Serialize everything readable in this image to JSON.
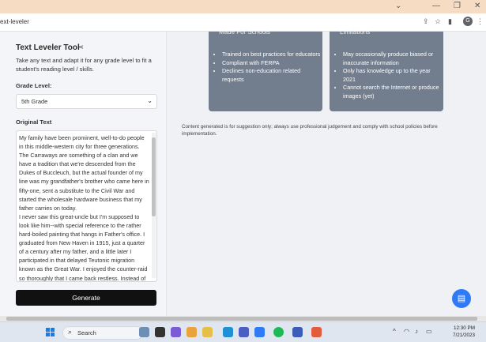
{
  "browser": {
    "window_controls": [
      "⌄",
      "—",
      "❐",
      "✕"
    ],
    "tab_text": "ext-leveler",
    "toolbar_icons": [
      "share-icon",
      "star-icon",
      "side-panel-icon",
      "profile-icon",
      "menu-icon"
    ],
    "profile_initial": "G"
  },
  "left_panel": {
    "title": "Text Leveler Tool",
    "description": "Take any text and adapt it for any grade level to fit a student's reading level / skills.",
    "grade_label": "Grade Level:",
    "grade_value": "5th Grade",
    "original_text_label": "Original Text",
    "original_text": "My family have been prominent, well-to-do people in this middle-western city for three generations. The Carraways are something of a clan and we have a tradition that we're descended from the Dukes of Buccleuch, but the actual founder of my line was my grandfather's brother who came here in fifty-one, sent a substitute to the Civil War and started the wholesale hardware business that my father carries on today.\nI never saw this great-uncle but I'm supposed to look like him--with special reference to the rather hard-boiled painting that hangs in Father's office. I graduated from New Haven in 1915, just a quarter of a century after my father, and a little later I participated in that delayed Teutonic migration known as the Great War. I enjoyed the counter-raid so thoroughly that I came back restless. Instead of being the",
    "generate_label": "Generate"
  },
  "cards": [
    {
      "heading": "Made For Schools",
      "items": [
        "Trained on best practices for educators",
        "Compliant with FERPA",
        "Declines non-education related requests"
      ]
    },
    {
      "heading": "Limitations",
      "items": [
        "May occasionally produce biased or inaccurate information",
        "Only has knowledge up to the year 2021",
        "Cannot search the Internet or produce images (yet)"
      ]
    }
  ],
  "disclaimer": "Content generated is for suggestion only; always use professional judgement and comply with school policies before implementation.",
  "taskbar": {
    "search_placeholder": "Search",
    "time": "12:30 PM",
    "date": "7/21/2023"
  },
  "colors": {
    "card_bg": "#727d8d",
    "generate_bg": "#111111",
    "chat_bg": "#2f7bf5",
    "title_bar": "#f6dcc3"
  }
}
